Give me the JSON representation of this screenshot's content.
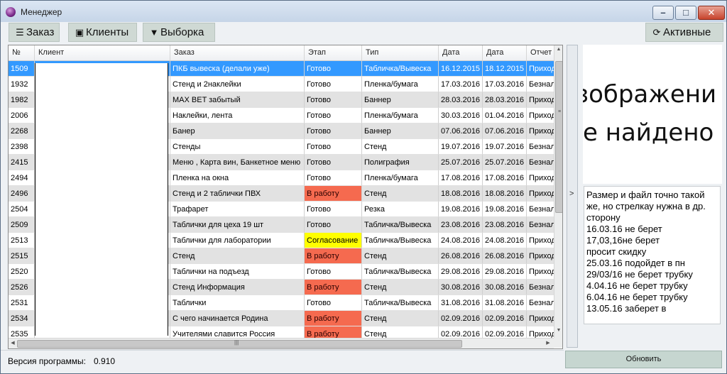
{
  "window": {
    "title": "Менеджер"
  },
  "toolbar": {
    "orders_label": "Заказ",
    "clients_label": "Клиенты",
    "selection_label": "Выборка",
    "active_label": "Активные"
  },
  "grid": {
    "columns": [
      "№",
      "Клиент",
      "Заказ",
      "Этап",
      "Тип",
      "Дата",
      "Дата",
      "Отчет"
    ],
    "rows": [
      {
        "num": "1509",
        "client": "",
        "order": "ПКБ вывеска (делали уже)",
        "stage": "Готово",
        "stage_color": "std",
        "type": "Табличка/Вывеска",
        "date1": "16.12.2015",
        "date2": "18.12.2015",
        "report": "Приход"
      },
      {
        "num": "1932",
        "client": "",
        "order": "Стенд и 2наклейки",
        "stage": "Готово",
        "stage_color": "std",
        "type": "Пленка/бумага",
        "date1": "17.03.2016",
        "date2": "17.03.2016",
        "report": "Безнал"
      },
      {
        "num": "1982",
        "client": "",
        "order": "MAX BET забытый",
        "stage": "Готово",
        "stage_color": "std",
        "type": "Баннер",
        "date1": "28.03.2016",
        "date2": "28.03.2016",
        "report": "Приход"
      },
      {
        "num": "2006",
        "client": "",
        "order": "Наклейки, лента",
        "stage": "Готово",
        "stage_color": "std",
        "type": "Пленка/бумага",
        "date1": "30.03.2016",
        "date2": "01.04.2016",
        "report": "Приход"
      },
      {
        "num": "2268",
        "client": "",
        "order": "Банер",
        "stage": "Готово",
        "stage_color": "std",
        "type": "Баннер",
        "date1": "07.06.2016",
        "date2": "07.06.2016",
        "report": "Приход"
      },
      {
        "num": "2398",
        "client": "",
        "order": "Стенды",
        "stage": "Готово",
        "stage_color": "std",
        "type": "Стенд",
        "date1": "19.07.2016",
        "date2": "19.07.2016",
        "report": "Безнал"
      },
      {
        "num": "2415",
        "client": "",
        "order": "Меню , Карта вин, Банкетное меню",
        "stage": "Готово",
        "stage_color": "std",
        "type": "Полиграфия",
        "date1": "25.07.2016",
        "date2": "25.07.2016",
        "report": "Безнал"
      },
      {
        "num": "2494",
        "client": "",
        "order": "Пленка на окна",
        "stage": "Готово",
        "stage_color": "std",
        "type": "Пленка/бумага",
        "date1": "17.08.2016",
        "date2": "17.08.2016",
        "report": "Приход"
      },
      {
        "num": "2496",
        "client": "",
        "order": "Стенд и 2 таблички ПВХ",
        "stage": "В работу",
        "stage_color": "work",
        "type": "Стенд",
        "date1": "18.08.2016",
        "date2": "18.08.2016",
        "report": "Приход"
      },
      {
        "num": "2504",
        "client": "",
        "order": "Трафарет",
        "stage": "Готово",
        "stage_color": "std",
        "type": "Резка",
        "date1": "19.08.2016",
        "date2": "19.08.2016",
        "report": "Безнал"
      },
      {
        "num": "2509",
        "client": "",
        "order": "Таблички для цеха 19 шт",
        "stage": "Готово",
        "stage_color": "std",
        "type": "Табличка/Вывеска",
        "date1": "23.08.2016",
        "date2": "23.08.2016",
        "report": "Безнал"
      },
      {
        "num": "2513",
        "client": "",
        "order": "Таблички для лаборатории",
        "stage": "Согласование",
        "stage_color": "agree",
        "type": "Табличка/Вывеска",
        "date1": "24.08.2016",
        "date2": "24.08.2016",
        "report": "Приход"
      },
      {
        "num": "2515",
        "client": "",
        "order": "Стенд",
        "stage": "В работу",
        "stage_color": "work",
        "type": "Стенд",
        "date1": "26.08.2016",
        "date2": "26.08.2016",
        "report": "Приход"
      },
      {
        "num": "2520",
        "client": "",
        "order": "Таблички на подъезд",
        "stage": "Готово",
        "stage_color": "std",
        "type": "Табличка/Вывеска",
        "date1": "29.08.2016",
        "date2": "29.08.2016",
        "report": "Приход"
      },
      {
        "num": "2526",
        "client": "",
        "order": "Стенд Информация",
        "stage": "В работу",
        "stage_color": "work",
        "type": "Стенд",
        "date1": "30.08.2016",
        "date2": "30.08.2016",
        "report": "Безнал"
      },
      {
        "num": "2531",
        "client": "",
        "order": "Таблички",
        "stage": "Готово",
        "stage_color": "std",
        "type": "Табличка/Вывеска",
        "date1": "31.08.2016",
        "date2": "31.08.2016",
        "report": "Безнал"
      },
      {
        "num": "2534",
        "client": "",
        "order": "С чего начинается Родина",
        "stage": "В работу",
        "stage_color": "work",
        "type": "Стенд",
        "date1": "02.09.2016",
        "date2": "02.09.2016",
        "report": "Приход"
      },
      {
        "num": "2535",
        "client": "",
        "order": "Учителями славится Россия",
        "stage": "В работу",
        "stage_color": "work",
        "type": "Стенд",
        "date1": "02.09.2016",
        "date2": "02.09.2016",
        "report": "Приход"
      }
    ]
  },
  "image_panel": {
    "line1": "зображени",
    "line2": "е найдено"
  },
  "notes": {
    "lines": [
      "Размер и файл точно такой же, но стрелкау нужна в др. сторону",
      "16.03.16 не берет",
      "17,03,16не берет",
      "просит скидку",
      "25.03.16 подойдет в пн",
      "29/03/16 не берет трубку",
      "4.04.16 не берет трубку",
      "6.04.16 не берет трубку",
      "13.05.16 заберет в"
    ]
  },
  "status": {
    "version_label": "Версия программы:",
    "version_value": "0.910"
  },
  "refresh_label": "Обновить"
}
